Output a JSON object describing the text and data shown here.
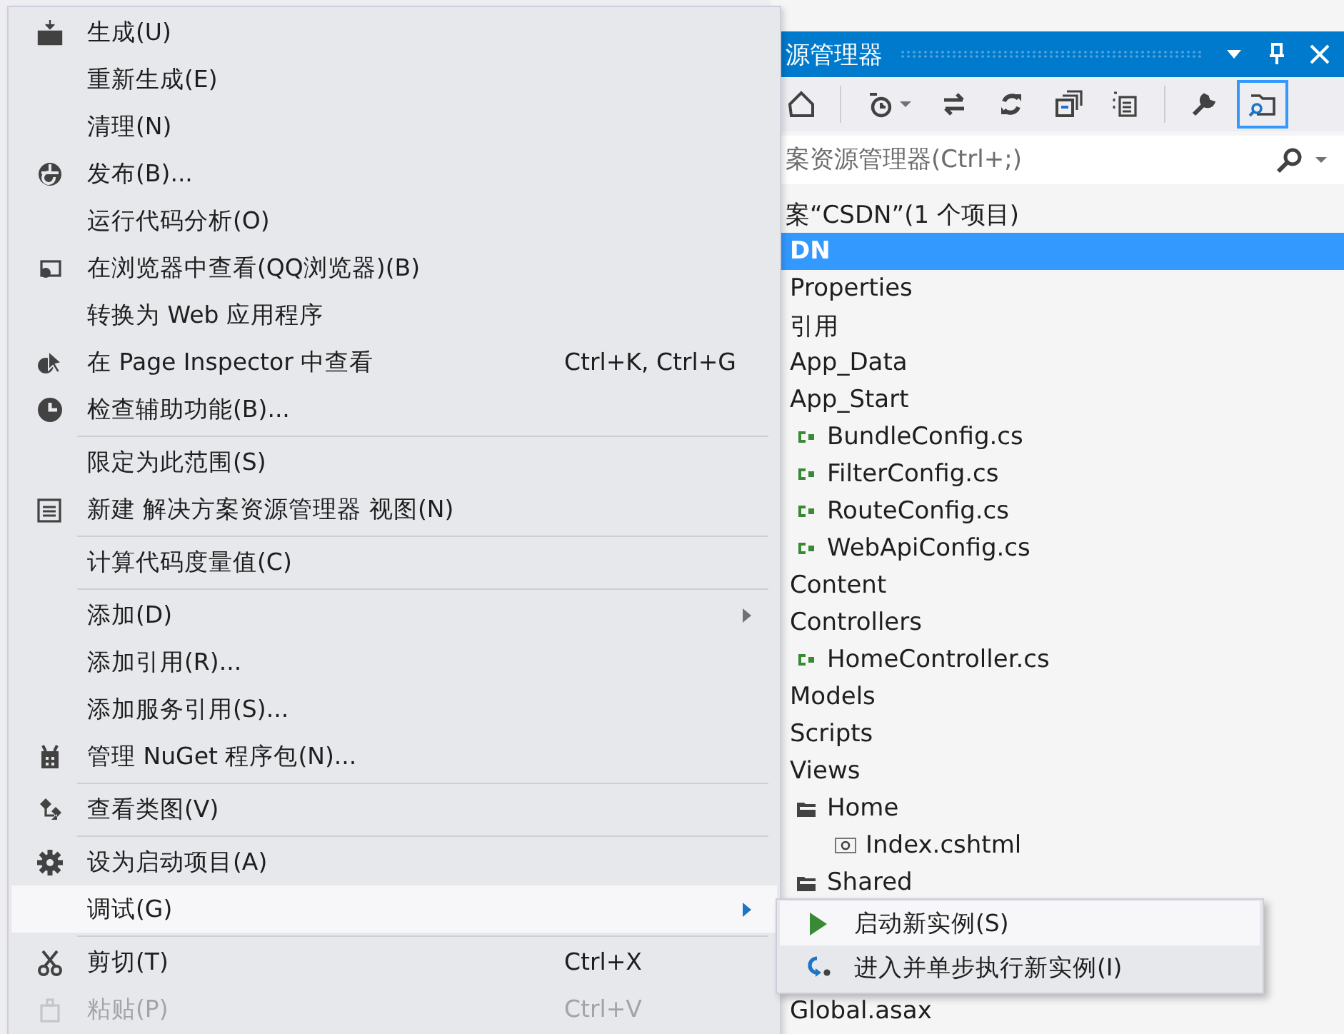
{
  "solution_explorer": {
    "title": "源管理器",
    "toolbar": [
      {
        "kind": "home",
        "on": false
      },
      {
        "kind": "separator"
      },
      {
        "kind": "history",
        "on": false
      },
      {
        "kind": "sync",
        "on": false
      },
      {
        "kind": "refresh",
        "on": false
      },
      {
        "kind": "collapse",
        "on": false
      },
      {
        "kind": "show-all",
        "on": false
      },
      {
        "kind": "separator"
      },
      {
        "kind": "properties",
        "on": false
      },
      {
        "kind": "preview",
        "on": true
      }
    ],
    "search": {
      "placeholder": "案资源管理器(Ctrl+;)"
    },
    "solution_label": "案“CSDN”(1 个项目)",
    "tree": [
      {
        "label": "DN",
        "selected": true
      },
      {
        "label": "Properties",
        "selected": false
      },
      {
        "label": "引用",
        "selected": false
      },
      {
        "label": "App_Data",
        "selected": false
      },
      {
        "label": "App_Start",
        "selected": false,
        "children": [
          {
            "label": "BundleConfig.cs",
            "kind": "cs",
            "selected": false
          },
          {
            "label": "FilterConfig.cs",
            "kind": "cs",
            "selected": false
          },
          {
            "label": "RouteConfig.cs",
            "kind": "cs",
            "selected": false
          },
          {
            "label": "WebApiConfig.cs",
            "kind": "cs",
            "selected": false
          }
        ]
      },
      {
        "label": "Content",
        "selected": false
      },
      {
        "label": "Controllers",
        "selected": false,
        "children": [
          {
            "label": "HomeController.cs",
            "kind": "cs",
            "selected": false
          }
        ]
      },
      {
        "label": "Models",
        "selected": false
      },
      {
        "label": "Scripts",
        "selected": false
      },
      {
        "label": "Views",
        "selected": false,
        "children": [
          {
            "label": "Home",
            "kind": "folder",
            "selected": false,
            "children": [
              {
                "label": "Index.cshtml",
                "kind": "cshtml",
                "selected": false
              }
            ]
          },
          {
            "label": "Shared",
            "kind": "folder",
            "selected": false
          }
        ]
      },
      {
        "label": "Global.asax",
        "selected": false
      }
    ]
  },
  "context_menu": {
    "items": [
      {
        "kind": "build",
        "label": "生成(U)",
        "submenu": false,
        "selected": false,
        "disabled": false
      },
      {
        "kind": "plain",
        "label": "重新生成(E)",
        "submenu": false,
        "selected": false,
        "disabled": false
      },
      {
        "kind": "plain",
        "label": "清理(N)",
        "submenu": false,
        "selected": false,
        "disabled": false
      },
      {
        "kind": "publish",
        "label": "发布(B)...",
        "submenu": false,
        "selected": false,
        "disabled": false
      },
      {
        "kind": "plain",
        "label": "运行代码分析(O)",
        "submenu": false,
        "selected": false,
        "disabled": false
      },
      {
        "kind": "browser",
        "label": "在浏览器中查看(QQ浏览器)(B)",
        "submenu": false,
        "selected": false,
        "disabled": false
      },
      {
        "kind": "plain",
        "label": "转换为 Web 应用程序",
        "submenu": false,
        "selected": false,
        "disabled": false
      },
      {
        "kind": "inspector",
        "label": "在 Page Inspector 中查看",
        "shortcut": "Ctrl+K, Ctrl+G",
        "submenu": false,
        "selected": false,
        "disabled": false
      },
      {
        "kind": "accessibility",
        "label": "检查辅助功能(B)...",
        "submenu": false,
        "selected": false,
        "disabled": false
      },
      {
        "kind": "separator"
      },
      {
        "kind": "plain",
        "label": "限定为此范围(S)",
        "submenu": false,
        "selected": false,
        "disabled": false
      },
      {
        "kind": "newview",
        "label": "新建 解决方案资源管理器 视图(N)",
        "submenu": false,
        "selected": false,
        "disabled": false
      },
      {
        "kind": "separator"
      },
      {
        "kind": "plain",
        "label": "计算代码度量值(C)",
        "submenu": false,
        "selected": false,
        "disabled": false
      },
      {
        "kind": "separator"
      },
      {
        "kind": "plain",
        "label": "添加(D)",
        "submenu": true,
        "selected": false,
        "disabled": false
      },
      {
        "kind": "plain",
        "label": "添加引用(R)...",
        "submenu": false,
        "selected": false,
        "disabled": false
      },
      {
        "kind": "plain",
        "label": "添加服务引用(S)...",
        "submenu": false,
        "selected": false,
        "disabled": false
      },
      {
        "kind": "nuget",
        "label": "管理 NuGet 程序包(N)...",
        "submenu": false,
        "selected": false,
        "disabled": false
      },
      {
        "kind": "separator"
      },
      {
        "kind": "classdiagram",
        "label": "查看类图(V)",
        "submenu": false,
        "selected": false,
        "disabled": false
      },
      {
        "kind": "separator"
      },
      {
        "kind": "gear",
        "label": "设为启动项目(A)",
        "submenu": false,
        "selected": false,
        "disabled": false
      },
      {
        "kind": "plain",
        "label": "调试(G)",
        "submenu": true,
        "selected": true,
        "disabled": false
      },
      {
        "kind": "separator"
      },
      {
        "kind": "cut",
        "label": "剪切(T)",
        "shortcut": "Ctrl+X",
        "submenu": false,
        "selected": false,
        "disabled": false
      },
      {
        "kind": "paste",
        "label": "粘贴(P)",
        "shortcut": "Ctrl+V",
        "submenu": false,
        "selected": false,
        "disabled": true
      }
    ]
  },
  "submenu": {
    "items": [
      {
        "kind": "play",
        "label": "启动新实例(S)",
        "selected": true
      },
      {
        "kind": "stepinto",
        "label": "进入并单步执行新实例(I)",
        "selected": false
      }
    ]
  }
}
